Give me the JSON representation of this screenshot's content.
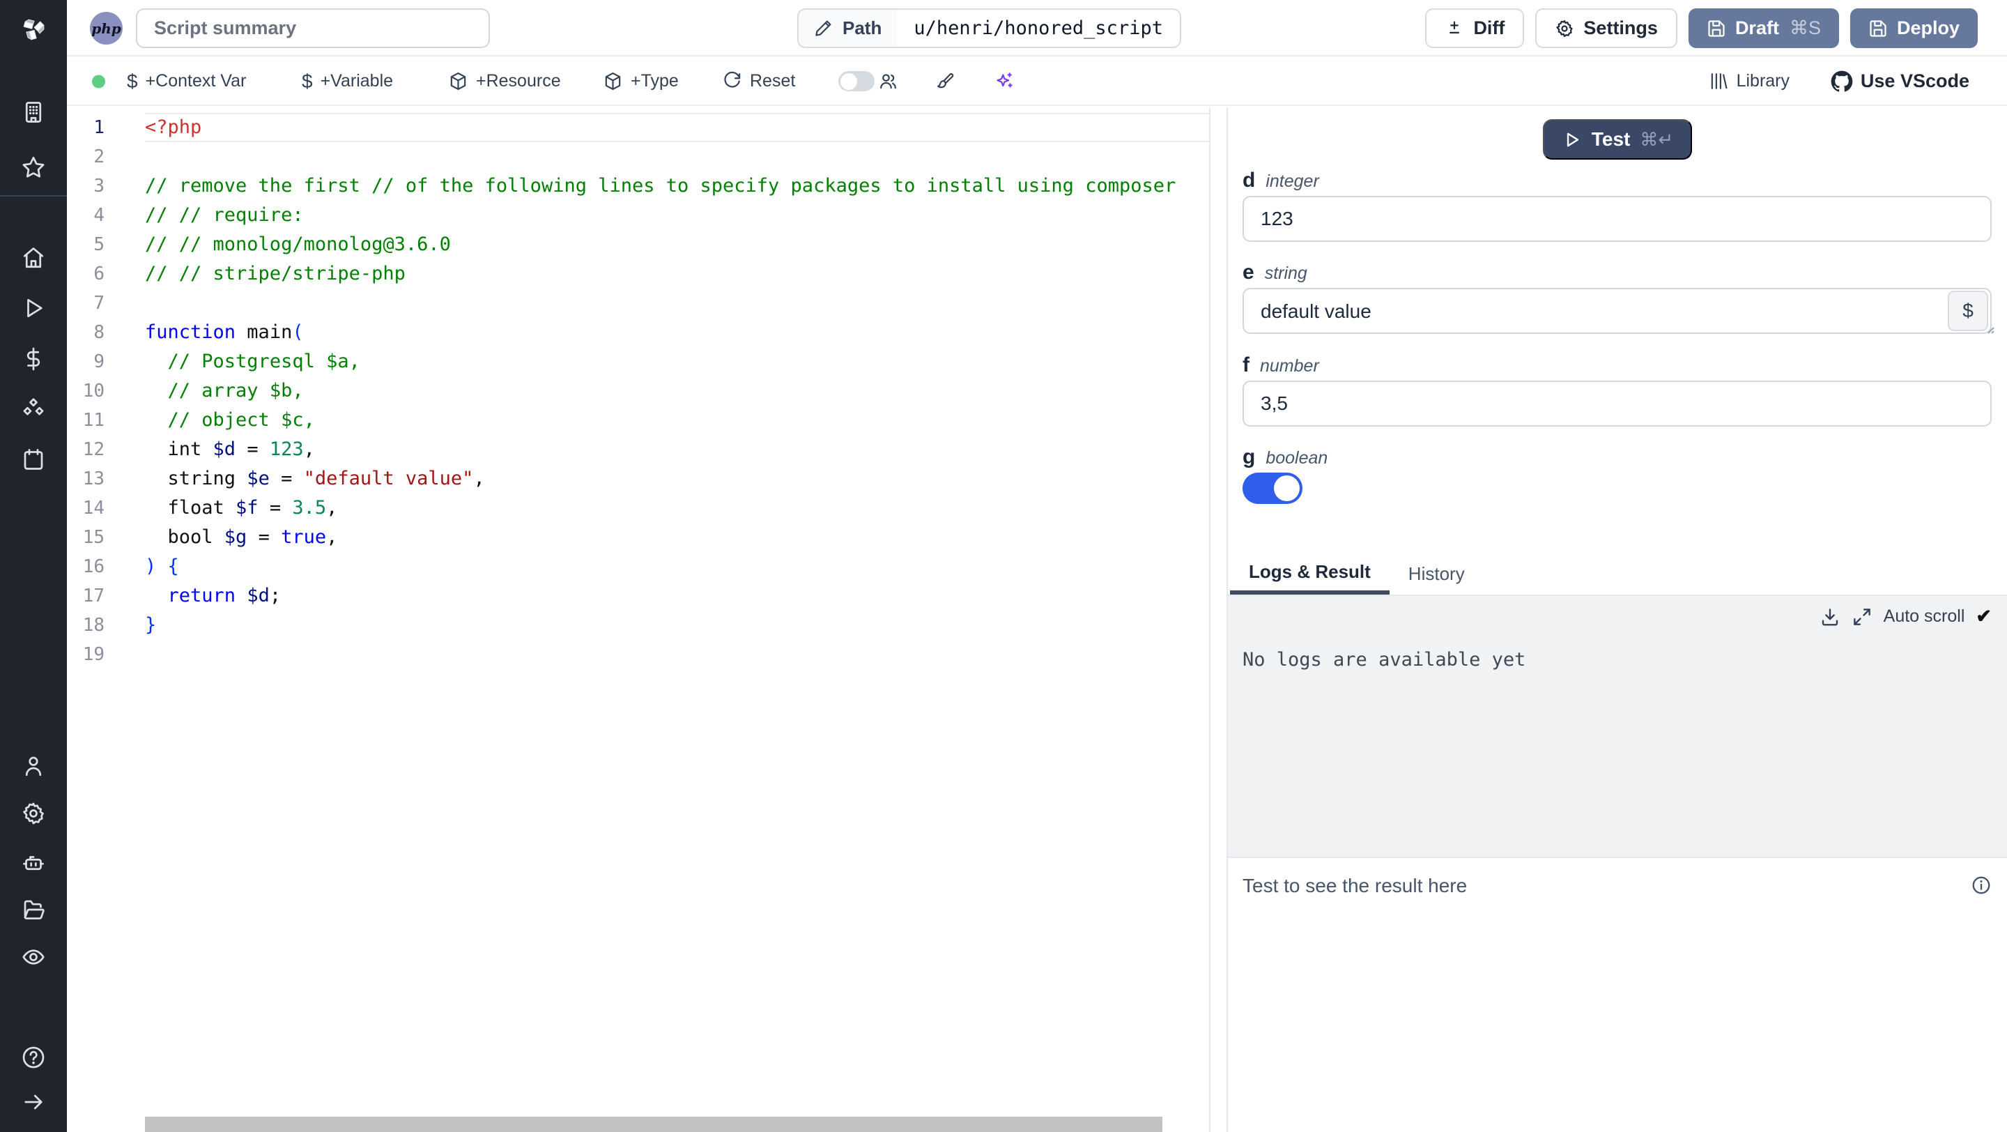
{
  "header": {
    "language_badge": "php",
    "summary_placeholder": "Script summary",
    "path_label": "Path",
    "path_value": "u/henri/honored_script",
    "diff_label": "Diff",
    "settings_label": "Settings",
    "draft_label": "Draft",
    "draft_shortcut": "⌘S",
    "deploy_label": "Deploy"
  },
  "toolbar": {
    "context_var_label": "+Context Var",
    "variable_label": "+Variable",
    "resource_label": "+Resource",
    "type_label": "+Type",
    "reset_label": "Reset",
    "library_label": "Library",
    "use_vscode_label": "Use VScode"
  },
  "editor": {
    "language": "php",
    "lines": [
      [
        {
          "t": "<?php",
          "c": "meta"
        }
      ],
      [],
      [
        {
          "t": "// remove the first // of the following lines to specify packages to install using composer",
          "c": "com"
        }
      ],
      [
        {
          "t": "// // require:",
          "c": "com"
        }
      ],
      [
        {
          "t": "// // monolog/monolog@3.6.0",
          "c": "com"
        }
      ],
      [
        {
          "t": "// // stripe/stripe-php",
          "c": "com"
        }
      ],
      [],
      [
        {
          "t": "function",
          "c": "kw"
        },
        {
          "t": " main",
          "c": "pl"
        },
        {
          "t": "(",
          "c": "br"
        }
      ],
      [
        {
          "t": "  ",
          "c": "pl"
        },
        {
          "t": "// Postgresql $a,",
          "c": "com"
        }
      ],
      [
        {
          "t": "  ",
          "c": "pl"
        },
        {
          "t": "// array $b,",
          "c": "com"
        }
      ],
      [
        {
          "t": "  ",
          "c": "pl"
        },
        {
          "t": "// object $c,",
          "c": "com"
        }
      ],
      [
        {
          "t": "  int ",
          "c": "pl"
        },
        {
          "t": "$d",
          "c": "var"
        },
        {
          "t": " = ",
          "c": "pl"
        },
        {
          "t": "123",
          "c": "num"
        },
        {
          "t": ",",
          "c": "pl"
        }
      ],
      [
        {
          "t": "  string ",
          "c": "pl"
        },
        {
          "t": "$e",
          "c": "var"
        },
        {
          "t": " = ",
          "c": "pl"
        },
        {
          "t": "\"default value\"",
          "c": "str"
        },
        {
          "t": ",",
          "c": "pl"
        }
      ],
      [
        {
          "t": "  float ",
          "c": "pl"
        },
        {
          "t": "$f",
          "c": "var"
        },
        {
          "t": " = ",
          "c": "pl"
        },
        {
          "t": "3.5",
          "c": "num"
        },
        {
          "t": ",",
          "c": "pl"
        }
      ],
      [
        {
          "t": "  bool ",
          "c": "pl"
        },
        {
          "t": "$g",
          "c": "var"
        },
        {
          "t": " = ",
          "c": "pl"
        },
        {
          "t": "true",
          "c": "kw"
        },
        {
          "t": ",",
          "c": "pl"
        }
      ],
      [
        {
          "t": ") {",
          "c": "br"
        }
      ],
      [
        {
          "t": "  ",
          "c": "pl"
        },
        {
          "t": "return",
          "c": "kw"
        },
        {
          "t": " ",
          "c": "pl"
        },
        {
          "t": "$d",
          "c": "var"
        },
        {
          "t": ";",
          "c": "pl"
        }
      ],
      [
        {
          "t": "}",
          "c": "br"
        }
      ],
      []
    ]
  },
  "panel": {
    "test_label": "Test",
    "test_shortcut": "⌘↵",
    "fields": [
      {
        "name": "d",
        "type": "integer",
        "value": "123"
      },
      {
        "name": "e",
        "type": "string",
        "value": "default value",
        "dollar_button": "$"
      },
      {
        "name": "f",
        "type": "number",
        "value": "3,5"
      },
      {
        "name": "g",
        "type": "boolean",
        "value": true
      }
    ],
    "tabs": [
      "Logs & Result",
      "History"
    ],
    "auto_scroll_label": "Auto scroll",
    "check_glyph": "✔",
    "no_logs_text": "No logs are available yet",
    "result_placeholder": "Test to see the result here"
  },
  "colors": {
    "sidebar_bg": "#20242c",
    "slate_button": "#66789b",
    "test_button": "#3a4767",
    "toggle_on": "#2f5eea",
    "status_dot": "#5fce84",
    "ai_sparkle": "#7c3aed",
    "logs_bg": "#f0f2f4"
  }
}
